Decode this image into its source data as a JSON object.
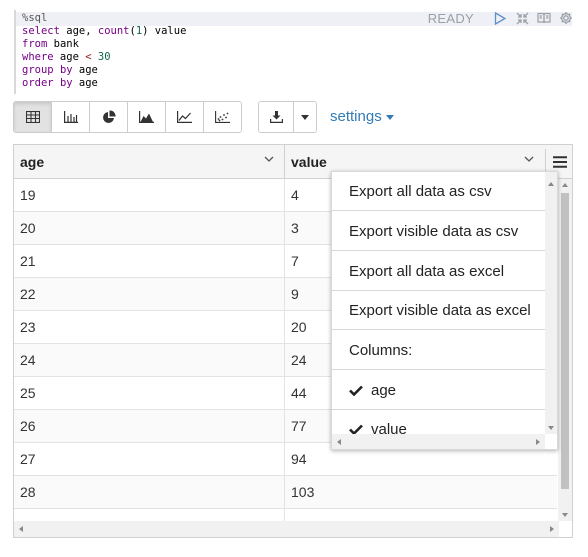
{
  "paragraph": {
    "status": "READY",
    "code_lines": [
      {
        "parts": [
          {
            "t": "%sql",
            "c": "meta"
          }
        ]
      },
      {
        "parts": [
          {
            "t": "select",
            "c": "kw"
          },
          {
            "t": " age, ",
            "c": ""
          },
          {
            "t": "count",
            "c": "kw"
          },
          {
            "t": "(",
            "c": ""
          },
          {
            "t": "1",
            "c": "num"
          },
          {
            "t": ") value",
            "c": ""
          }
        ]
      },
      {
        "parts": [
          {
            "t": "from",
            "c": "kw"
          },
          {
            "t": " bank",
            "c": ""
          }
        ]
      },
      {
        "parts": [
          {
            "t": "where",
            "c": "kw"
          },
          {
            "t": " age ",
            "c": ""
          },
          {
            "t": "<",
            "c": "op"
          },
          {
            "t": " ",
            "c": ""
          },
          {
            "t": "30",
            "c": "num"
          }
        ]
      },
      {
        "parts": [
          {
            "t": "group",
            "c": "kw"
          },
          {
            "t": " ",
            "c": ""
          },
          {
            "t": "by",
            "c": "kw"
          },
          {
            "t": " age",
            "c": ""
          }
        ]
      },
      {
        "parts": [
          {
            "t": "order",
            "c": "kw"
          },
          {
            "t": " ",
            "c": ""
          },
          {
            "t": "by",
            "c": "kw"
          },
          {
            "t": " age",
            "c": ""
          }
        ]
      }
    ],
    "tools": [
      "run-icon",
      "collapse-icon",
      "book-icon",
      "gear-icon"
    ]
  },
  "toolbar": {
    "chart_buttons": [
      "table-icon",
      "bar-chart-icon",
      "pie-chart-icon",
      "area-chart-icon",
      "line-chart-icon",
      "scatter-chart-icon"
    ],
    "active": "table-icon",
    "download": "download-icon",
    "settings_label": "settings"
  },
  "table": {
    "columns": [
      "age",
      "value"
    ],
    "rows": [
      [
        "19",
        "4"
      ],
      [
        "20",
        "3"
      ],
      [
        "21",
        "7"
      ],
      [
        "22",
        "9"
      ],
      [
        "23",
        "20"
      ],
      [
        "24",
        "24"
      ],
      [
        "25",
        "44"
      ],
      [
        "26",
        "77"
      ],
      [
        "27",
        "94"
      ],
      [
        "28",
        "103"
      ]
    ]
  },
  "export_menu": {
    "items": [
      "Export all data as csv",
      "Export visible data as csv",
      "Export all data as excel",
      "Export visible data as excel"
    ],
    "columns_label": "Columns:",
    "column_toggles": [
      {
        "label": "age",
        "checked": true
      },
      {
        "label": "value",
        "checked": true
      }
    ]
  },
  "colors": {
    "accent": "#337ab7",
    "keyword": "#770088",
    "number": "#116644"
  }
}
